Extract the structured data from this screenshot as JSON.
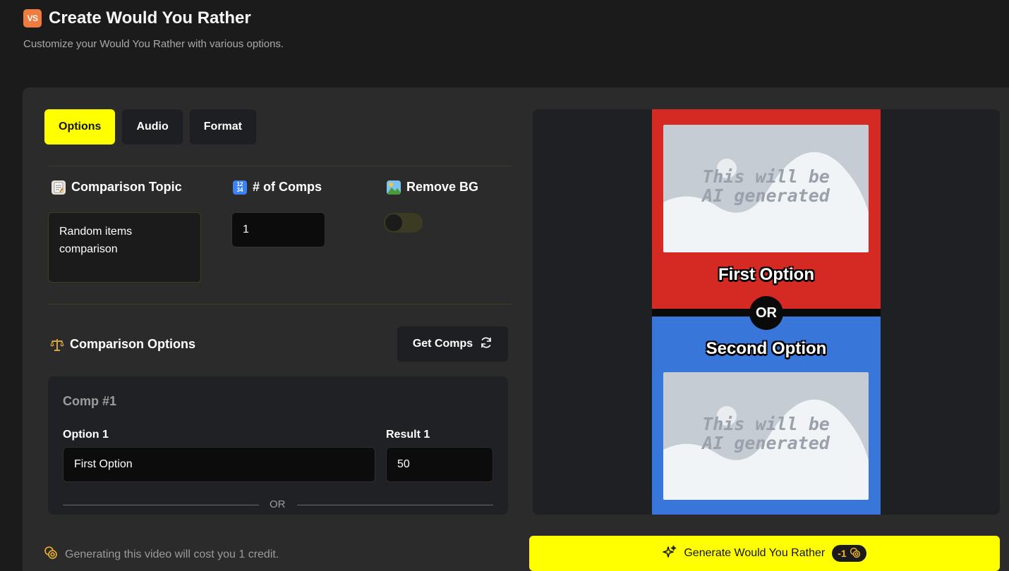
{
  "header": {
    "badge": "VS",
    "title": "Create Would You Rather",
    "subtitle": "Customize your Would You Rather with various options."
  },
  "tabs": [
    {
      "label": "Options",
      "active": true
    },
    {
      "label": "Audio",
      "active": false
    },
    {
      "label": "Format",
      "active": false
    }
  ],
  "fields": {
    "topic_label": "Comparison Topic",
    "topic_value": "Random items comparison",
    "comps_label": "# of Comps",
    "comps_value": "1",
    "removebg_label": "Remove BG",
    "removebg_on": false
  },
  "comparison": {
    "section_label": "Comparison Options",
    "get_comps_label": "Get Comps",
    "comp_title": "Comp #1",
    "option1_label": "Option 1",
    "option1_value": "First Option",
    "result1_label": "Result 1",
    "result1_value": "50",
    "or_text": "OR"
  },
  "preview": {
    "placeholder_line1": "This will be",
    "placeholder_line2": "AI generated",
    "first_option": "First Option",
    "or_label": "OR",
    "second_option": "Second Option"
  },
  "footer": {
    "cost_note": "Generating this video will cost you 1 credit.",
    "generate_label": "Generate Would You Rather",
    "cost_badge": "-1"
  },
  "colors": {
    "accent": "#ffff00",
    "red_panel": "#d42a23",
    "blue_panel": "#3877d9",
    "coin": "#f0b429"
  }
}
